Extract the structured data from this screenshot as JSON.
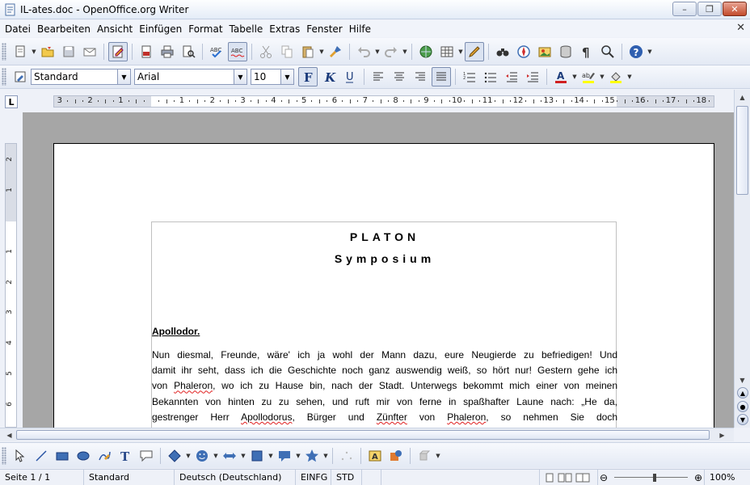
{
  "window": {
    "title": "IL-ates.doc - OpenOffice.org Writer",
    "minimize_label": "–",
    "maximize_label": "❐",
    "close_label": "✕"
  },
  "menu": {
    "items": [
      {
        "label": "Datei"
      },
      {
        "label": "Bearbeiten"
      },
      {
        "label": "Ansicht"
      },
      {
        "label": "Einfügen"
      },
      {
        "label": "Format"
      },
      {
        "label": "Tabelle"
      },
      {
        "label": "Extras"
      },
      {
        "label": "Fenster"
      },
      {
        "label": "Hilfe"
      }
    ],
    "close_doc": "✕"
  },
  "formatting": {
    "style": "Standard",
    "font": "Arial",
    "size": "10"
  },
  "ruler": {
    "h_numbers": [
      "3",
      "2",
      "1",
      "1",
      "2",
      "3",
      "4",
      "5",
      "6",
      "7",
      "8",
      "9",
      "10",
      "11",
      "12",
      "13",
      "14",
      "15",
      "16",
      "17",
      "18"
    ],
    "v_numbers": [
      "2",
      "1",
      "1",
      "2",
      "3",
      "4",
      "5",
      "6"
    ]
  },
  "document": {
    "author": "PLATON",
    "work": "Symposium",
    "speaker": "Apollodor.",
    "lines": [
      [
        {
          "t": "Nun diesmal, Freunde, wäre' ich ja wohl der Mann dazu, eure Neugierde zu befriedigen! Und"
        }
      ],
      [
        {
          "t": "damit ihr seht, dass ich die Geschichte noch ganz auswendig weiß, so hört nur! Gestern gehe ich"
        }
      ],
      [
        {
          "t": "von "
        },
        {
          "t": "Phaleron",
          "s": true
        },
        {
          "t": ", wo ich zu Hause bin, nach der Stadt. Unterwegs bekommt mich einer von meinen"
        }
      ],
      [
        {
          "t": "Bekannten von hinten zu zu sehen, und ruft mir von ferne in spaßhafter Laune nach: „He da,"
        }
      ],
      [
        {
          "t": "gestrenger Herr "
        },
        {
          "t": "Apollodorus",
          "s": true
        },
        {
          "t": ", Bürger und "
        },
        {
          "t": "Zünfter",
          "s": true
        },
        {
          "t": " von "
        },
        {
          "t": "Phaleron",
          "s": true
        },
        {
          "t": ", so nehmen Sie doch"
        }
      ]
    ]
  },
  "status": {
    "page": "Seite 1 / 1",
    "style": "Standard",
    "language": "Deutsch (Deutschland)",
    "insert": "EINFG",
    "selection": "STD",
    "zoom": "100%"
  },
  "colors": {
    "accent": "#3f6fb5",
    "spellcheck": "#e02020"
  }
}
